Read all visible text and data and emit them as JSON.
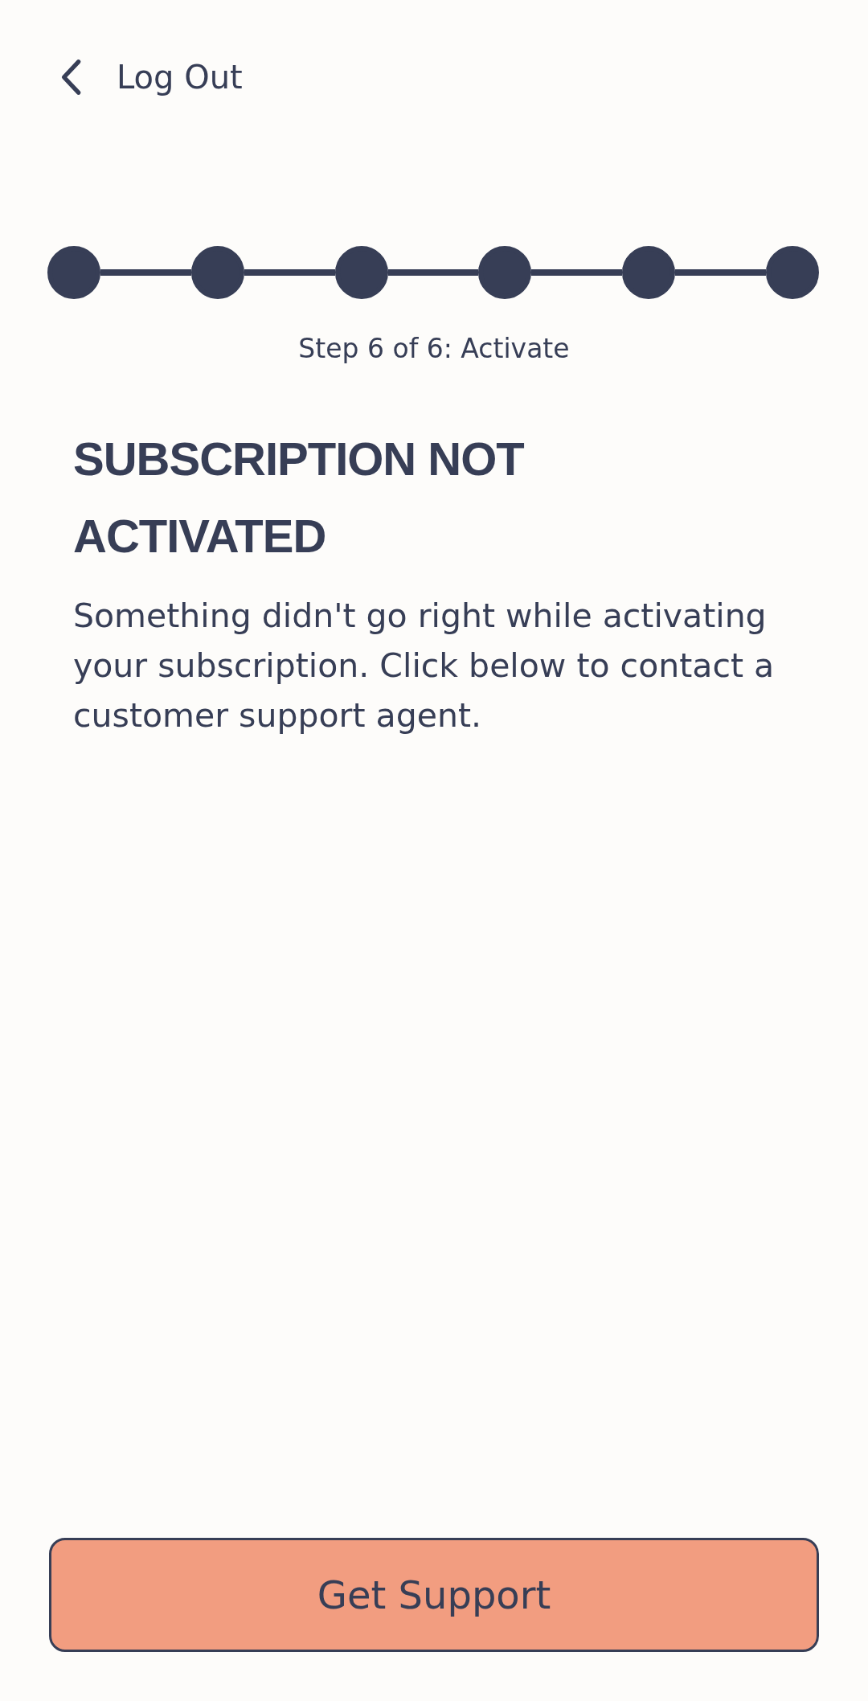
{
  "header": {
    "back_label": "Log Out"
  },
  "stepper": {
    "steps": [
      {
        "completed": true
      },
      {
        "completed": true
      },
      {
        "completed": true
      },
      {
        "completed": true
      },
      {
        "completed": true
      },
      {
        "completed": true
      }
    ],
    "caption": "Step 6 of 6: Activate"
  },
  "title": "SUBSCRIPTION NOT ACTIVATED",
  "message": "Something didn't go right while activating your subscription. Click below to contact a customer support agent.",
  "button": {
    "label": "Get Support"
  }
}
